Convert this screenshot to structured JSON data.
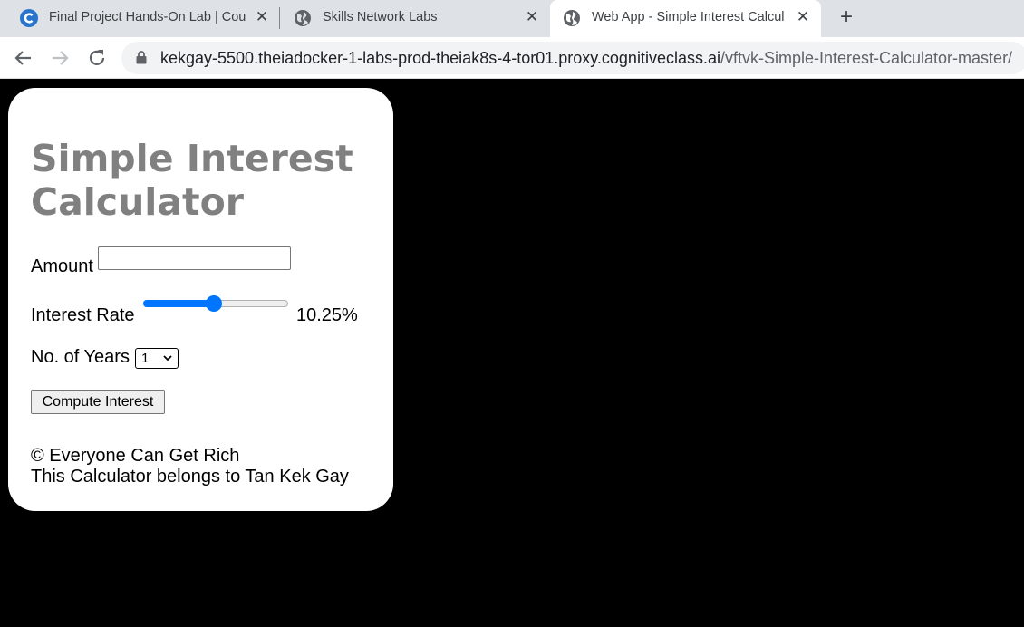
{
  "browser": {
    "tabs": [
      {
        "title": "Final Project Hands-On Lab | Cou",
        "icon": "coursera-icon",
        "active": false
      },
      {
        "title": "Skills Network Labs",
        "icon": "globe-icon",
        "active": false
      },
      {
        "title": "Web App - Simple Interest Calcul",
        "icon": "globe-icon",
        "active": true
      }
    ],
    "new_tab_label": "+",
    "url_host": "kekgay-5500.theiadocker-1-labs-prod-theiak8s-4-tor01.proxy.cognitiveclass.ai",
    "url_path": "/vftvk-Simple-Interest-Calculator-master/"
  },
  "app": {
    "title": "Simple Interest Calculator",
    "amount_label": "Amount",
    "amount_value": "",
    "rate_label": "Interest Rate",
    "rate_value": 10.25,
    "rate_display": "10.25%",
    "rate_fraction": 0.49,
    "years_label": "No. of Years",
    "years_value": "1",
    "compute_label": "Compute Interest",
    "footer_copyright": "© Everyone Can Get Rich",
    "footer_owner": "This Calculator belongs to Tan Kek Gay"
  },
  "colors": {
    "tabstrip_bg": "#dee1e6",
    "accent": "#0075ff",
    "heading": "#808080",
    "page_bg": "#000000"
  }
}
